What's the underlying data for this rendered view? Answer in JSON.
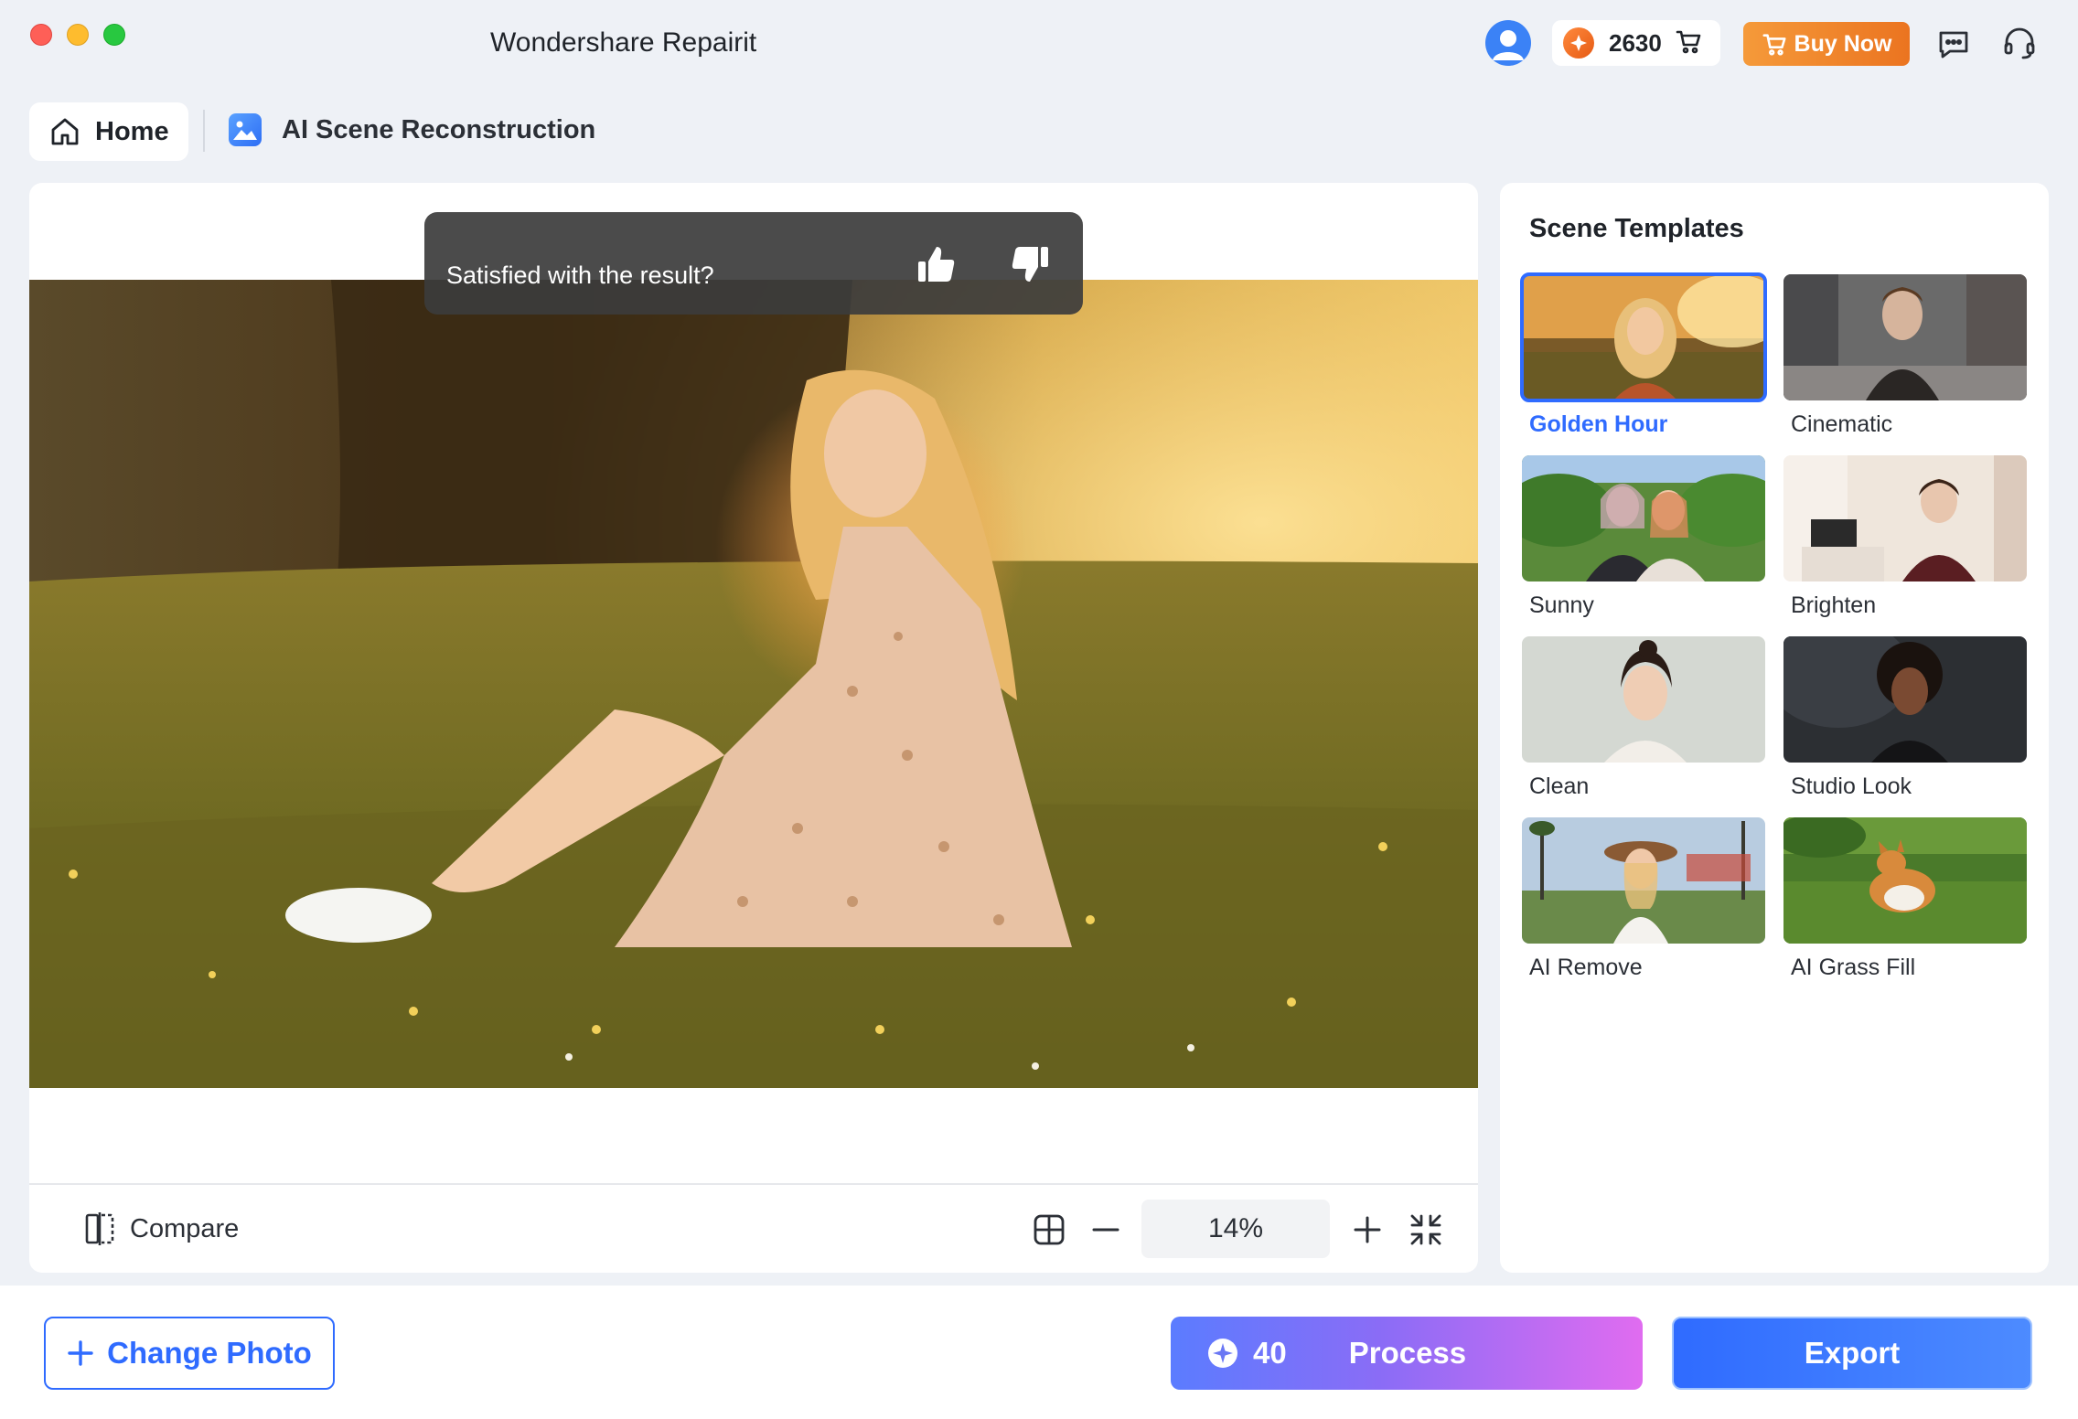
{
  "window": {
    "title": "Wondershare Repairit"
  },
  "header": {
    "credits": "2630",
    "buy_now_label": "Buy Now",
    "icons": [
      "user-avatar-icon",
      "coin-icon",
      "cart-icon",
      "chat-icon",
      "headset-icon"
    ]
  },
  "breadcrumb": {
    "home_label": "Home",
    "page_label": "AI Scene Reconstruction"
  },
  "canvas": {
    "feedback_prompt": "Satisfied with the result?",
    "compare_label": "Compare",
    "zoom_level": "14%"
  },
  "templates": {
    "title": "Scene Templates",
    "selected": "Golden Hour",
    "items": [
      {
        "label": "Golden Hour",
        "selected": true
      },
      {
        "label": "Cinematic",
        "selected": false
      },
      {
        "label": "Sunny",
        "selected": false
      },
      {
        "label": "Brighten",
        "selected": false
      },
      {
        "label": "Clean",
        "selected": false
      },
      {
        "label": "Studio Look",
        "selected": false
      },
      {
        "label": "AI Remove",
        "selected": false
      },
      {
        "label": "AI Grass Fill",
        "selected": false
      }
    ]
  },
  "footer": {
    "change_photo_label": "Change Photo",
    "process_cost": "40",
    "process_label": "Process",
    "export_label": "Export"
  },
  "colors": {
    "accent": "#2f6bff",
    "buy_now": "#f08a2c",
    "window_bg": "#eef1f6"
  }
}
